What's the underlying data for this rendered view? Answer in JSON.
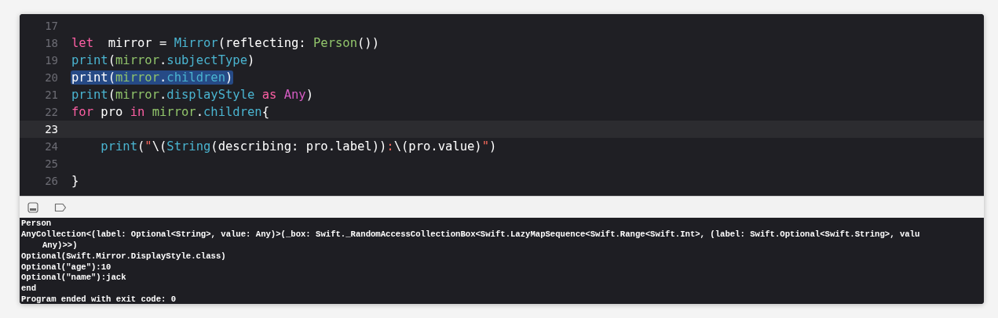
{
  "editor": {
    "lines": [
      {
        "number": "17",
        "current": false
      },
      {
        "number": "18",
        "current": false,
        "selected": false,
        "tokens": [
          {
            "kind": "keyword",
            "text": "let"
          },
          {
            "kind": "plain",
            "text": "  mirror = "
          },
          {
            "kind": "call",
            "text": "Mirror"
          },
          {
            "kind": "plain",
            "text": "(reflecting: "
          },
          {
            "kind": "ident",
            "text": "Person"
          },
          {
            "kind": "plain",
            "text": "())"
          }
        ]
      },
      {
        "number": "19",
        "current": false,
        "selected": false,
        "tokens": [
          {
            "kind": "call",
            "text": "print"
          },
          {
            "kind": "plain",
            "text": "("
          },
          {
            "kind": "ident",
            "text": "mirror"
          },
          {
            "kind": "plain",
            "text": "."
          },
          {
            "kind": "call",
            "text": "subjectType"
          },
          {
            "kind": "plain",
            "text": ")"
          }
        ]
      },
      {
        "number": "20",
        "current": false,
        "selected": true,
        "tokens": [
          {
            "kind": "plain",
            "text": "print("
          },
          {
            "kind": "ident",
            "text": "mirror"
          },
          {
            "kind": "plain",
            "text": "."
          },
          {
            "kind": "call",
            "text": "children"
          },
          {
            "kind": "plain",
            "text": ")"
          }
        ]
      },
      {
        "number": "21",
        "current": false,
        "selected": false,
        "tokens": [
          {
            "kind": "call",
            "text": "print"
          },
          {
            "kind": "plain",
            "text": "("
          },
          {
            "kind": "ident",
            "text": "mirror"
          },
          {
            "kind": "plain",
            "text": "."
          },
          {
            "kind": "call",
            "text": "displayStyle"
          },
          {
            "kind": "keyword",
            "text": " as"
          },
          {
            "kind": "type",
            "text": " Any"
          },
          {
            "kind": "plain",
            "text": ")"
          }
        ]
      },
      {
        "number": "22",
        "current": false,
        "selected": false,
        "tokens": [
          {
            "kind": "keyword",
            "text": "for"
          },
          {
            "kind": "plain",
            "text": " pro "
          },
          {
            "kind": "keyword",
            "text": "in"
          },
          {
            "kind": "ident",
            "text": " mirror"
          },
          {
            "kind": "plain",
            "text": "."
          },
          {
            "kind": "call",
            "text": "children"
          },
          {
            "kind": "plain",
            "text": "{"
          }
        ]
      },
      {
        "number": "23",
        "current": true
      },
      {
        "number": "24",
        "current": false,
        "selected": false,
        "tokens": [
          {
            "kind": "call",
            "text": "    print"
          },
          {
            "kind": "plain",
            "text": "("
          },
          {
            "kind": "string",
            "text": "\""
          },
          {
            "kind": "plain",
            "text": "\\("
          },
          {
            "kind": "call",
            "text": "String"
          },
          {
            "kind": "plain",
            "text": "(describing: pro.label))"
          },
          {
            "kind": "string",
            "text": ":"
          },
          {
            "kind": "plain",
            "text": "\\(pro.value)"
          },
          {
            "kind": "string",
            "text": "\""
          },
          {
            "kind": "plain",
            "text": ")"
          }
        ]
      },
      {
        "number": "25",
        "current": false
      },
      {
        "number": "26",
        "current": false,
        "selected": false,
        "tokens": [
          {
            "kind": "plain",
            "text": "}"
          }
        ]
      }
    ]
  },
  "console": {
    "lines": [
      {
        "kind": "line",
        "text": "Person"
      },
      {
        "kind": "line",
        "text": "AnyCollection<(label: Optional<String>, value: Any)>(_box: Swift._RandomAccessCollectionBox<Swift.LazyMapSequence<Swift.Range<Swift.Int>, (label: Swift.Optional<Swift.String>, valu"
      },
      {
        "kind": "continuation",
        "text": "Any)>>)"
      },
      {
        "kind": "line",
        "text": "Optional(Swift.Mirror.DisplayStyle.class)"
      },
      {
        "kind": "line",
        "text": "Optional(\"age\"):10"
      },
      {
        "kind": "line",
        "text": "Optional(\"name\"):jack"
      },
      {
        "kind": "line",
        "text": "end"
      },
      {
        "kind": "line",
        "text": "Program ended with exit code: 0"
      }
    ]
  }
}
